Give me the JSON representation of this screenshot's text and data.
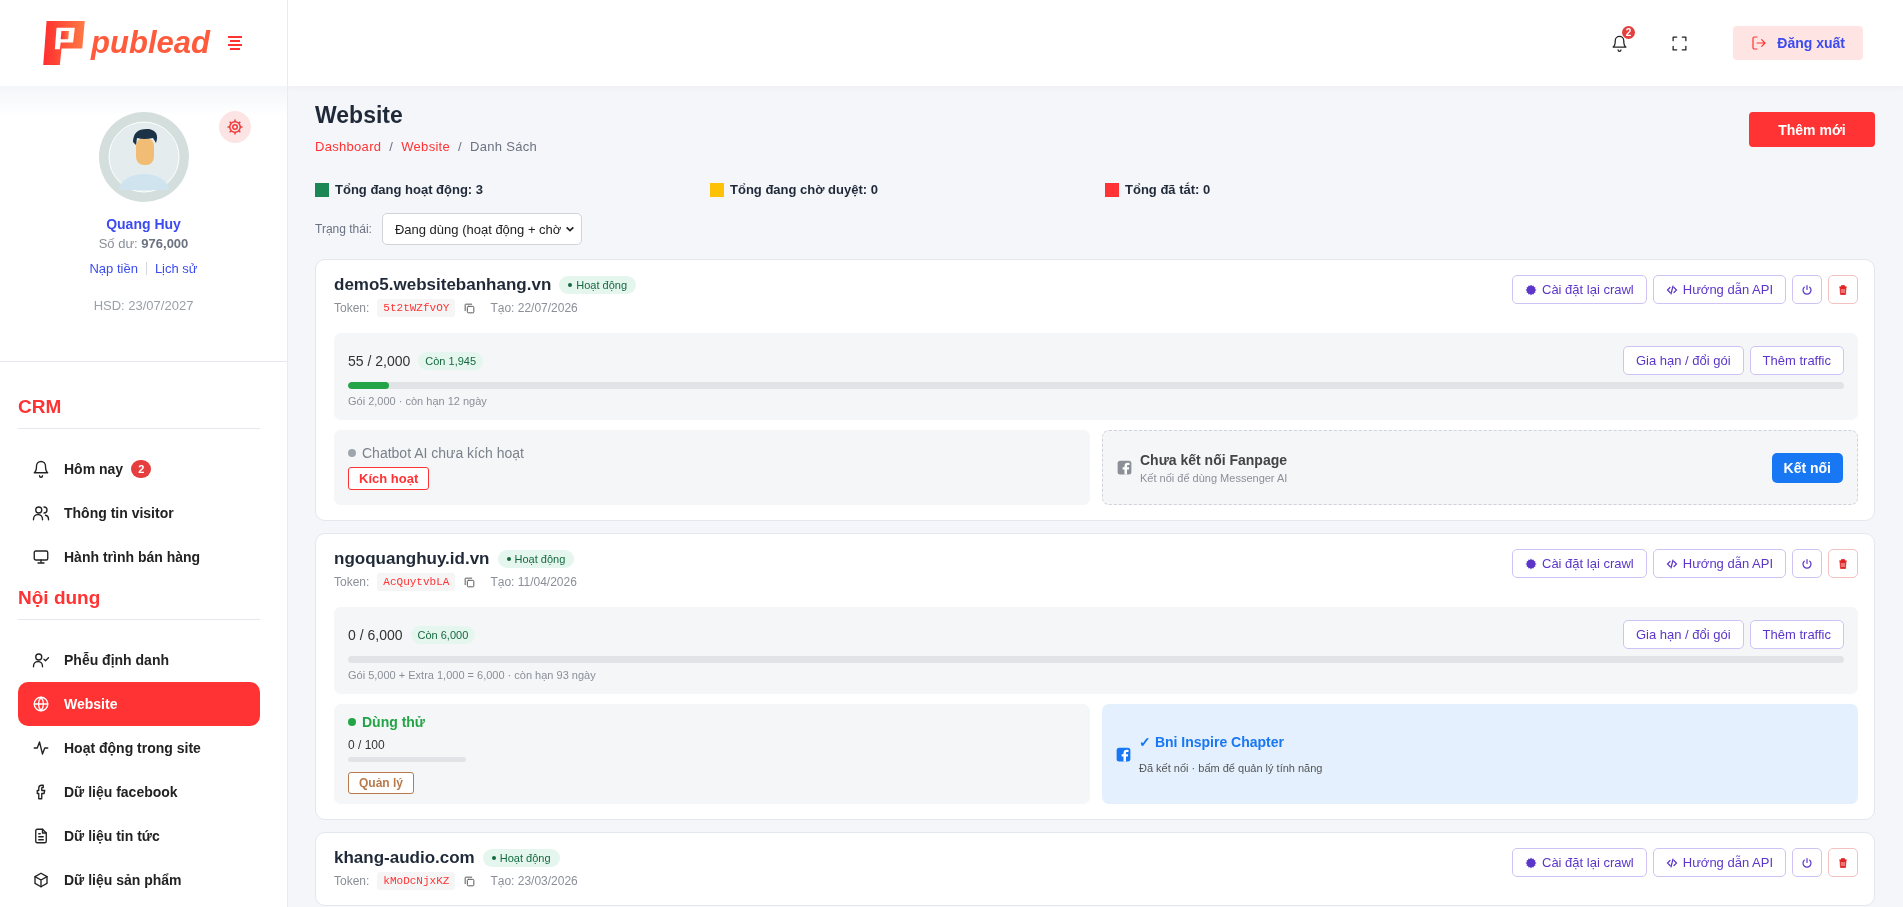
{
  "brand": {
    "name": "publead"
  },
  "profile": {
    "name": "Quang Huy",
    "balance_label": "Số dư:",
    "balance": "976,000",
    "links": [
      "Nạp tiền",
      "Lịch sử"
    ],
    "expiry": "HSD: 23/07/2027"
  },
  "sidebar": {
    "sections": [
      {
        "title": "CRM",
        "items": [
          {
            "label": "Hôm nay",
            "badge": "2",
            "selected": false
          },
          {
            "label": "Thông tin visitor",
            "selected": false
          },
          {
            "label": "Hành trình bán hàng",
            "selected": false
          }
        ]
      },
      {
        "title": "Nội dung",
        "items": [
          {
            "label": "Phễu định danh",
            "selected": false
          },
          {
            "label": "Website",
            "selected": true
          },
          {
            "label": "Hoạt động trong site",
            "selected": false
          },
          {
            "label": "Dữ liệu facebook",
            "selected": false
          },
          {
            "label": "Dữ liệu tin tức",
            "selected": false
          },
          {
            "label": "Dữ liệu sản phẩm",
            "selected": false
          }
        ]
      }
    ]
  },
  "header": {
    "notification_count": "2",
    "logout": "Đăng xuất"
  },
  "page": {
    "title": "Website",
    "breadcrumb_separator": "/",
    "breadcrumb": [
      {
        "label": "Dashboard",
        "link": true
      },
      {
        "label": "Website",
        "link": true
      },
      {
        "label": "Danh Sách",
        "link": false
      }
    ],
    "add_button": "Thêm mới"
  },
  "stats": [
    {
      "label": "Tổng đang hoạt động: 3",
      "color": "#1a8754"
    },
    {
      "label": "Tổng đang chờ duyệt: 0",
      "color": "#ffc107"
    },
    {
      "label": "Tổng đã tắt: 0",
      "color": "#ff3333"
    }
  ],
  "filter": {
    "label": "Trạng thái:",
    "value": "Đang dùng (hoạt động + chờ"
  },
  "sites": [
    {
      "domain": "demo5.websitebanhang.vn",
      "status": {
        "label": "Hoạt động",
        "kind": "active"
      },
      "token_label": "Token:",
      "token": "5t2tWZfvOY",
      "created": "Tạo: 22/07/2026",
      "actions": [
        "Cài đặt lại crawl",
        "Hướng dẫn API"
      ],
      "usage": "55 / 2,000",
      "remaining": "Còn 1,945",
      "level": 0.0275,
      "plan_note": "Gói 2,000 · còn hạn 12 ngày",
      "renew": "Gia hạn / đổi gói",
      "add_traffic": "Thêm traffic",
      "chatbot": {
        "kind": "inactive",
        "label": "Chatbot AI chưa kích hoạt",
        "button": "Kích hoạt"
      },
      "fanpage": {
        "kind": "disconnected",
        "title": "Chưa kết nối Fanpage",
        "subtitle": "Kết nối để dùng Messenger AI",
        "button": "Kết nối"
      }
    },
    {
      "domain": "ngoquanghuy.id.vn",
      "status": {
        "label": "Hoạt động",
        "kind": "active"
      },
      "token_label": "Token:",
      "token": "AcQuytvbLA",
      "created": "Tạo: 11/04/2026",
      "actions": [
        "Cài đặt lại crawl",
        "Hướng dẫn API"
      ],
      "usage": "0 / 6,000",
      "remaining": "Còn 6,000",
      "level": 0,
      "plan_note": "Gói 5,000 + Extra 1,000 = 6,000 · còn hạn 93 ngày",
      "renew": "Gia hạn / đổi gói",
      "add_traffic": "Thêm traffic",
      "chatbot": {
        "kind": "trial",
        "label": "Dùng thử",
        "count": "0 / 100",
        "level": 0,
        "button": "Quản lý"
      },
      "fanpage": {
        "kind": "connected",
        "title": "✓ Bni Inspire Chapter",
        "subtitle": "Đã kết nối · bấm để quản lý tính năng"
      }
    },
    {
      "domain": "khang-audio.com",
      "status": {
        "label": "Hoạt động",
        "kind": "active"
      },
      "token_label": "Token:",
      "token": "kMoDcNjxKZ",
      "created": "Tạo: 23/03/2026",
      "actions": [
        "Cài đặt lại crawl",
        "Hướng dẫn API"
      ]
    }
  ]
}
